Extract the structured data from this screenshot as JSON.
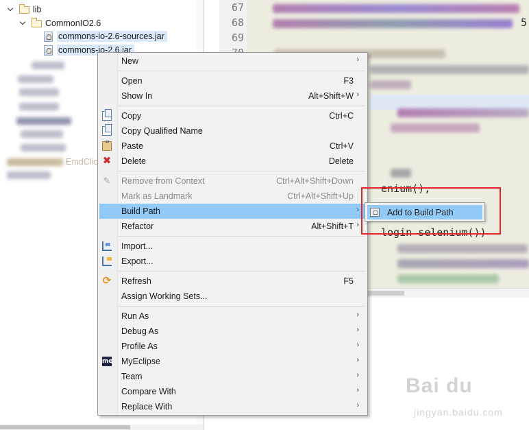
{
  "tree": {
    "folder_lib": "lib",
    "folder_commonio": "CommonIO2.6",
    "jar_sources": "commons-io-2.6-sources.jar",
    "jar_main": "commons-io-2.6.jar",
    "partial_label": "EmdClic"
  },
  "editor": {
    "line_numbers": [
      "67",
      "68",
      "69",
      "70"
    ],
    "visible_code": [
      "5",
      "enium(),",
      "login selenium())",
      "ium()"
    ]
  },
  "context_menu": {
    "items": [
      {
        "label": "New",
        "shortcut": "",
        "submenu": true
      },
      {
        "label": "Open",
        "shortcut": "F3"
      },
      {
        "label": "Show In",
        "shortcut": "Alt+Shift+W",
        "submenu": true
      },
      {
        "label": "Copy",
        "shortcut": "Ctrl+C",
        "icon": "copy-icon"
      },
      {
        "label": "Copy Qualified Name",
        "shortcut": "",
        "icon": "copy-qualified-icon"
      },
      {
        "label": "Paste",
        "shortcut": "Ctrl+V",
        "icon": "paste-icon"
      },
      {
        "label": "Delete",
        "shortcut": "Delete",
        "icon": "delete-icon"
      },
      {
        "label": "Remove from Context",
        "shortcut": "Ctrl+Alt+Shift+Down",
        "icon": "remove-context-icon",
        "disabled": true
      },
      {
        "label": "Mark as Landmark",
        "shortcut": "Ctrl+Alt+Shift+Up",
        "disabled": true
      },
      {
        "label": "Build Path",
        "shortcut": "",
        "submenu": true,
        "highlighted": true
      },
      {
        "label": "Refactor",
        "shortcut": "Alt+Shift+T",
        "submenu": true
      },
      {
        "label": "Import...",
        "shortcut": "",
        "icon": "import-icon"
      },
      {
        "label": "Export...",
        "shortcut": "",
        "icon": "export-icon"
      },
      {
        "label": "Refresh",
        "shortcut": "F5",
        "icon": "refresh-icon"
      },
      {
        "label": "Assign Working Sets...",
        "shortcut": ""
      },
      {
        "label": "Run As",
        "shortcut": "",
        "submenu": true
      },
      {
        "label": "Debug As",
        "shortcut": "",
        "submenu": true
      },
      {
        "label": "Profile As",
        "shortcut": "",
        "submenu": true
      },
      {
        "label": "MyEclipse",
        "shortcut": "",
        "submenu": true,
        "icon": "myeclipse-icon"
      },
      {
        "label": "Team",
        "shortcut": "",
        "submenu": true
      },
      {
        "label": "Compare With",
        "shortcut": "",
        "submenu": true
      },
      {
        "label": "Replace With",
        "shortcut": "",
        "submenu": true
      }
    ],
    "myeclipse_badge": "me"
  },
  "submenu": {
    "item": "Add to Build Path"
  },
  "watermark": {
    "logo": "Bai du",
    "url": "jingyan.baidu.com"
  },
  "colors": {
    "highlight": "#91c9f7",
    "annotation_box": "#e02525"
  }
}
